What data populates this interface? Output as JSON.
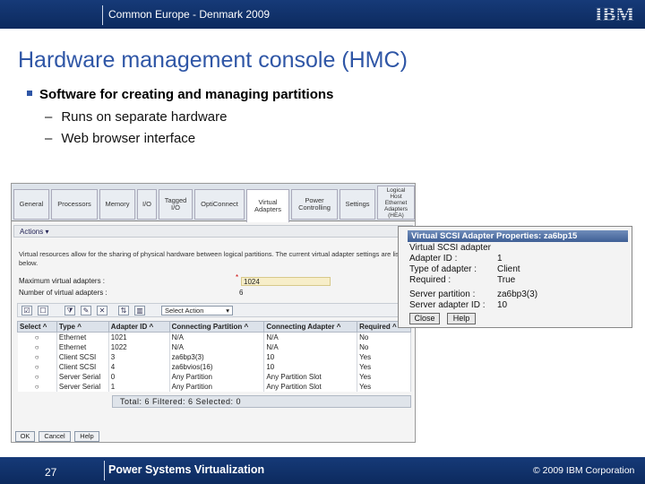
{
  "header": {
    "conference": "Common Europe - Denmark 2009",
    "logo": "IBM"
  },
  "slide": {
    "title": "Hardware management console (HMC)",
    "bullet": "Software for creating and managing partitions",
    "subbullets": [
      "Runs on separate hardware",
      "Web browser interface"
    ],
    "dash": "–"
  },
  "hmc": {
    "tabs": [
      "General",
      "Processors",
      "Memory",
      "I/O",
      "Tagged I/O",
      "OptiConnect",
      "Virtual Adapters",
      "Power Controlling",
      "Settings",
      "Logical Host Ethernet Adapters (HEA)"
    ],
    "actions": "Actions ▾",
    "description": "Virtual resources allow for the sharing of physical hardware between logical partitions. The current virtual adapter settings are listed below.",
    "max_label": "Maximum virtual adapters :",
    "max_star": "*",
    "max_value": "1024",
    "num_label": "Number of virtual adapters :",
    "num_value": "6",
    "select_action": "Select Action",
    "columns": [
      "Select ^",
      "Type ^",
      "Adapter ID ^",
      "Connecting Partition ^",
      "Connecting Adapter ^",
      "Required ^"
    ],
    "rows": [
      [
        "○",
        "Ethernet",
        "1021",
        "N/A",
        "N/A",
        "No"
      ],
      [
        "○",
        "Ethernet",
        "1022",
        "N/A",
        "N/A",
        "No"
      ],
      [
        "○",
        "Client SCSI",
        "3",
        "za6bp3(3)",
        "10",
        "Yes"
      ],
      [
        "○",
        "Client SCSI",
        "4",
        "za6bvios(16)",
        "10",
        "Yes"
      ],
      [
        "○",
        "Server Serial",
        "0",
        "Any Partition",
        "Any Partition Slot",
        "Yes"
      ],
      [
        "○",
        "Server Serial",
        "1",
        "Any Partition",
        "Any Partition Slot",
        "Yes"
      ]
    ],
    "totals": "Total: 6    Filtered: 6    Selected: 0",
    "buttons": [
      "OK",
      "Cancel",
      "Help"
    ]
  },
  "dialog": {
    "title": "Virtual SCSI Adapter Properties: za6bp15",
    "rows": [
      {
        "label": "Virtual SCSI adapter",
        "value": ""
      },
      {
        "label": "Adapter ID :",
        "value": "1"
      },
      {
        "label": "Type of adapter :",
        "value": "Client"
      },
      {
        "label": "Required :",
        "value": "True"
      },
      {
        "label": "Server partition :",
        "value": "za6bp3(3)"
      },
      {
        "label": "Server adapter ID :",
        "value": "10"
      }
    ],
    "close": "Close",
    "help": "Help"
  },
  "footer": {
    "page": "27",
    "product": "Power Systems Virtualization",
    "copyright": "© 2009 IBM Corporation"
  },
  "colors": {
    "bar": "#163a78",
    "title": "#2f56a6"
  }
}
